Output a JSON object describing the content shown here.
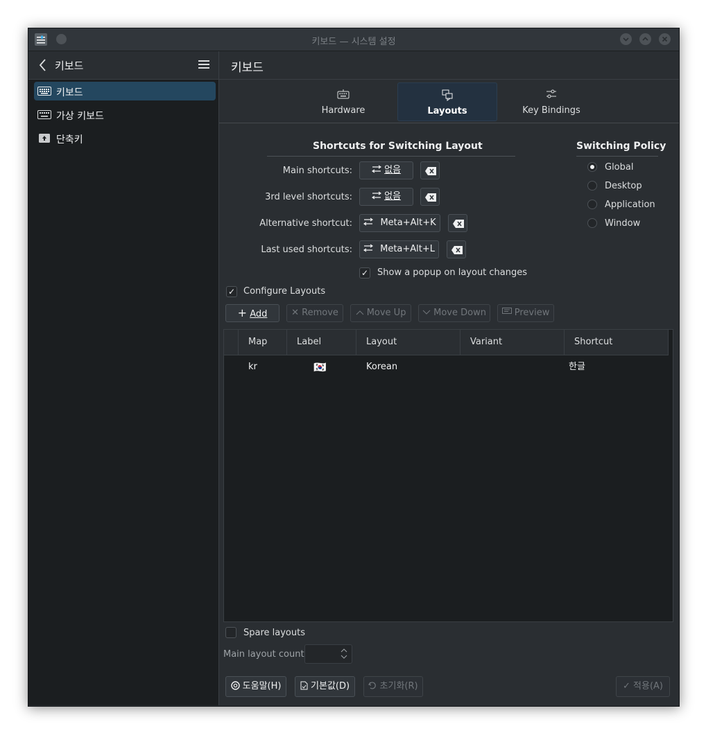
{
  "window": {
    "title": "키보드 — 시스템 설정",
    "buttons": [
      "minimize",
      "maximize",
      "close"
    ]
  },
  "sidebar": {
    "title": "키보드",
    "items": [
      {
        "label": "키보드",
        "icon": "keyboard-icon",
        "active": true
      },
      {
        "label": "가상 키보드",
        "icon": "virtual-keyboard-icon",
        "active": false
      },
      {
        "label": "단축키",
        "icon": "shortcuts-icon",
        "active": false
      }
    ]
  },
  "main": {
    "title": "키보드",
    "tabs": [
      {
        "label": "Hardware",
        "icon": "keyboard-icon",
        "active": false
      },
      {
        "label": "Layouts",
        "icon": "layouts-icon",
        "active": true
      },
      {
        "label": "Key Bindings",
        "icon": "key-bindings-icon",
        "active": false
      }
    ]
  },
  "shortcuts": {
    "title": "Shortcuts for Switching Layout",
    "rows": [
      {
        "label": "Main shortcuts:",
        "value": "없음"
      },
      {
        "label": "3rd level shortcuts:",
        "value": "없음"
      },
      {
        "label": "Alternative shortcut:",
        "value": "Meta+Alt+K"
      },
      {
        "label": "Last used shortcuts:",
        "value": "Meta+Alt+L"
      }
    ],
    "popup_label": "Show a popup on layout changes",
    "popup_checked": true
  },
  "policy": {
    "title": "Switching Policy",
    "options": [
      "Global",
      "Desktop",
      "Application",
      "Window"
    ],
    "selected": "Global"
  },
  "layouts": {
    "configure_label": "Configure Layouts",
    "configure_checked": true,
    "buttons": {
      "add": "Add",
      "remove": "Remove",
      "move_up": "Move Up",
      "move_down": "Move Down",
      "preview": "Preview"
    },
    "columns": [
      "Map",
      "Label",
      "Layout",
      "Variant",
      "Shortcut"
    ],
    "rows": [
      {
        "map": "kr",
        "label": "🇰🇷",
        "layout": "Korean",
        "variant": "",
        "shortcut": "한글"
      }
    ],
    "spare_label": "Spare layouts",
    "spare_checked": false,
    "main_count_label": "Main layout count:",
    "main_count_value": ""
  },
  "footer": {
    "help": "도움말(H)",
    "defaults": "기본값(D)",
    "reset": "초기화(R)",
    "apply": "적용(A)"
  },
  "colors": {
    "accent": "#3daee9",
    "selection": "#24475f",
    "window_bg": "#2a2e32",
    "view_bg": "#1b1e20"
  }
}
